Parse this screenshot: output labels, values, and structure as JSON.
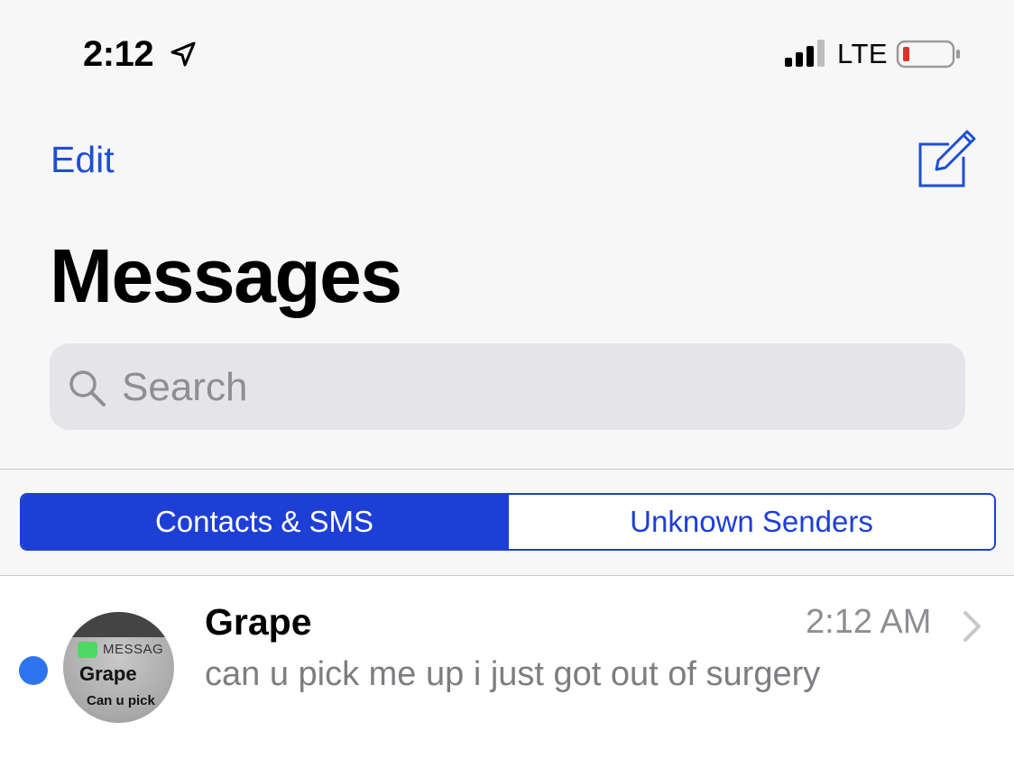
{
  "status_bar": {
    "time": "2:12",
    "network": "LTE",
    "icons": [
      "location-arrow-icon",
      "signal-bars-icon",
      "battery-low-icon"
    ],
    "battery_color": "#e0312b"
  },
  "nav": {
    "edit_label": "Edit",
    "compose_icon": "compose-icon",
    "title": "Messages"
  },
  "search": {
    "placeholder": "Search",
    "icon": "search-icon"
  },
  "filter": {
    "tabs": [
      {
        "label": "Contacts & SMS",
        "selected": true
      },
      {
        "label": "Unknown Senders",
        "selected": false
      }
    ]
  },
  "conversations": [
    {
      "name": "Grape",
      "time": "2:12 AM",
      "preview": "can u pick me up i just got out of surgery",
      "unread": true,
      "avatar": {
        "app_label": "MESSAG",
        "name": "Grape",
        "preview": "Can u pick"
      }
    }
  ],
  "colors": {
    "accent": "#1d3fd6",
    "unread_dot": "#2e74ee",
    "background": "#f7f7f7",
    "search_bg": "#e5e5e9",
    "secondary_text": "#8e8e93"
  }
}
